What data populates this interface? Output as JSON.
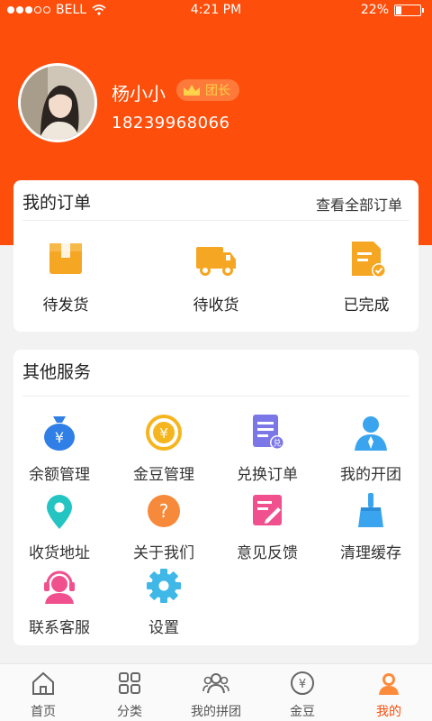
{
  "status_bar": {
    "carrier": "BELL",
    "time": "4:21 PM",
    "battery": "22%",
    "battery_level": 0.22
  },
  "profile": {
    "name": "杨小小",
    "badge": "团长",
    "phone": "18239968066"
  },
  "orders": {
    "title": "我的订单",
    "view_all": "查看全部订单",
    "items": [
      {
        "label": "待发货",
        "icon": "box-icon"
      },
      {
        "label": "待收货",
        "icon": "truck-icon"
      },
      {
        "label": "已完成",
        "icon": "completed-doc-icon"
      }
    ]
  },
  "services": {
    "title": "其他服务",
    "items": [
      {
        "label": "余额管理",
        "icon": "money-bag-icon"
      },
      {
        "label": "金豆管理",
        "icon": "yen-coin-icon"
      },
      {
        "label": "兑换订单",
        "icon": "exchange-doc-icon"
      },
      {
        "label": "我的开团",
        "icon": "person-icon"
      },
      {
        "label": "收货地址",
        "icon": "location-pin-icon"
      },
      {
        "label": "关于我们",
        "icon": "question-icon"
      },
      {
        "label": "意见反馈",
        "icon": "feedback-edit-icon"
      },
      {
        "label": "清理缓存",
        "icon": "broom-icon"
      },
      {
        "label": "联系客服",
        "icon": "headset-icon"
      },
      {
        "label": "设置",
        "icon": "gear-icon"
      }
    ]
  },
  "tabbar": {
    "tabs": [
      {
        "label": "首页",
        "icon": "home-icon"
      },
      {
        "label": "分类",
        "icon": "grid-icon"
      },
      {
        "label": "我的拼团",
        "icon": "group-icon"
      },
      {
        "label": "金豆",
        "icon": "yen-circle-icon"
      },
      {
        "label": "我的",
        "icon": "profile-icon"
      }
    ],
    "active": "我的"
  },
  "colors": {
    "brand": "#fe4e0b",
    "order_icon": "#f5a623",
    "badge_text": "#ffd24a"
  }
}
